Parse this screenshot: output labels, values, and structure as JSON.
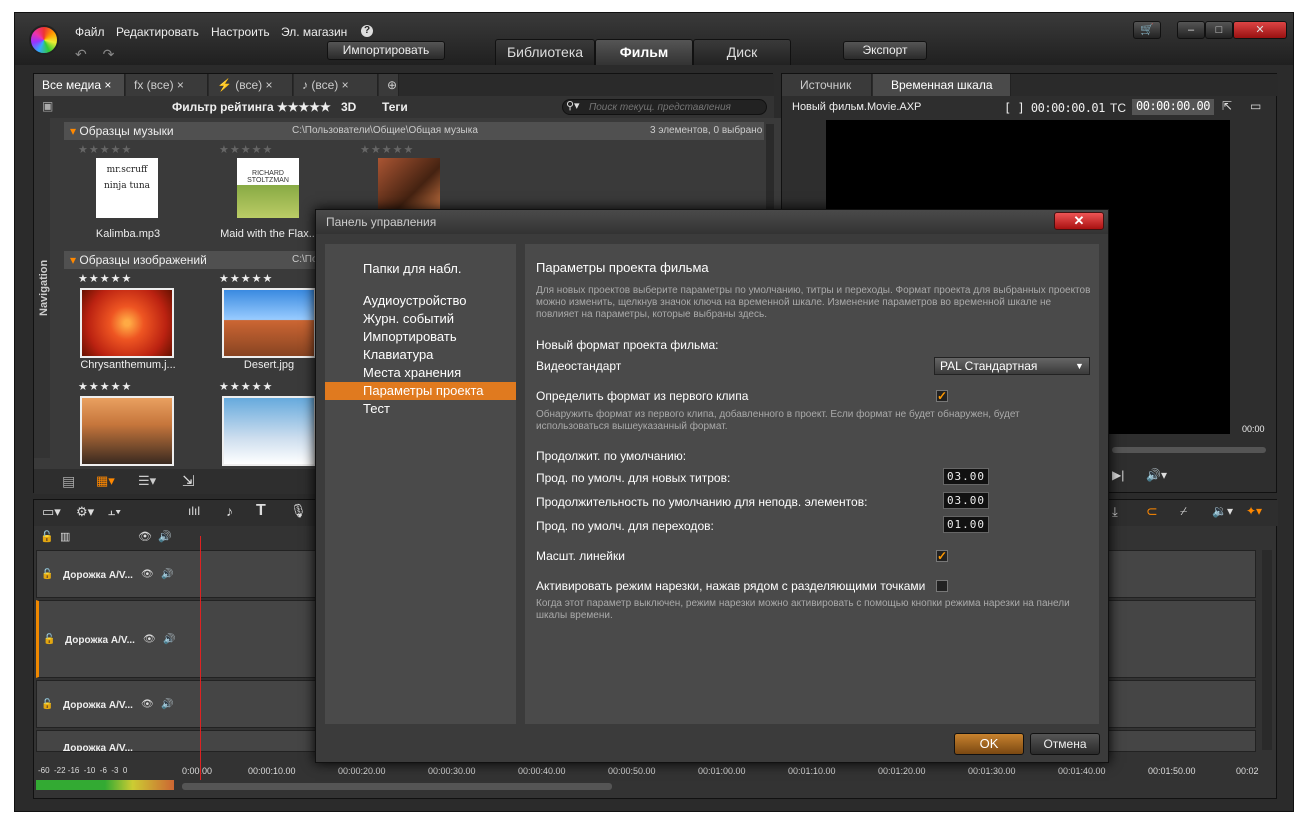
{
  "menu": {
    "file": "Файл",
    "edit": "Редактировать",
    "settings": "Настроить",
    "store": "Эл. магазин",
    "help": "?"
  },
  "toolbar": {
    "import": "Импортировать",
    "export": "Экспорт",
    "undo": "↶ ↷"
  },
  "main_tabs": [
    {
      "label": "Библиотека"
    },
    {
      "label": "Фильм"
    },
    {
      "label": "Диск"
    }
  ],
  "window_controls": {
    "cart": "🛒",
    "min": "–",
    "max": "□",
    "close": "✕"
  },
  "library": {
    "tabs": [
      {
        "label": "Все медиа ×"
      },
      {
        "label": "fx (все) ×"
      },
      {
        "label": "⚡ (все) ×"
      },
      {
        "label": "♪ (все) ×"
      }
    ],
    "rating_filter": "Фильтр рейтинга ★★★★★",
    "threed": "3D",
    "tags": "Теги",
    "search_placeholder": "Поиск текущ. представления",
    "navigation": "Navigation",
    "music_section": {
      "title": "Образцы музыки",
      "path": "C:\\Пользователи\\Общие\\Общая музыка",
      "count": "3 элементов, 0 выбрано"
    },
    "image_section": {
      "title": "Образцы изображений",
      "path": "C:\\Польз"
    },
    "music_items": [
      {
        "name": "Kalimba.mp3",
        "stars": "★★★★★",
        "cover": "mr.scruff ninja tuna"
      },
      {
        "name": "Maid with the Flax...",
        "stars": "★★★★★",
        "cover": "RICHARD STOLTZMAN"
      },
      {
        "name": "",
        "stars": "★★★★★"
      }
    ],
    "image_items": [
      {
        "name": "Chrysanthemum.j...",
        "stars": "★★★★★"
      },
      {
        "name": "Desert.jpg",
        "stars": "★★★★★"
      },
      {
        "name": "",
        "stars": "★★★★★"
      },
      {
        "name": "",
        "stars": "★★★★★"
      }
    ]
  },
  "preview": {
    "tabs": [
      {
        "label": "Источник"
      },
      {
        "label": "Временная шкала"
      }
    ],
    "file": "Новый фильм.Movie.AXP",
    "duration": "[ ] 00:00:00.01",
    "tc_label": "TC",
    "tc": "00:00:00.00",
    "time_end": "00:00"
  },
  "timeline": {
    "tracks": [
      {
        "label": "Дорожка A/V..."
      },
      {
        "label": "Дорожка A/V..."
      },
      {
        "label": "Дорожка A/V..."
      },
      {
        "label": "Дорожка A/V..."
      }
    ],
    "ruler": [
      "0:00.00",
      "00:00:10.00",
      "00:00:20.00",
      "00:00:30.00",
      "00:00:40.00",
      "00:00:50.00",
      "00:01:00.00",
      "00:01:10.00",
      "00:01:20.00",
      "00:01:30.00",
      "00:01:40.00",
      "00:01:50.00",
      "00:02"
    ],
    "meter": "-60  -22 -16  -10  -6  -3  0"
  },
  "dialog": {
    "title": "Панель управления",
    "close": "✕",
    "nav": [
      {
        "label": "Папки для набл."
      },
      {
        "label": "Аудиоустройство"
      },
      {
        "label": "Журн. событий"
      },
      {
        "label": "Импортировать"
      },
      {
        "label": "Клавиатура"
      },
      {
        "label": "Места хранения"
      },
      {
        "label": "Параметры проекта"
      },
      {
        "label": "Тест"
      }
    ],
    "heading": "Параметры проекта фильма",
    "intro": "Для новых проектов выберите параметры по умолчанию, титры и переходы. Формат проекта для выбранных проектов можно изменить, щелкнув значок ключа на временной шкале. Изменение параметров во временной шкале не повлияет на параметры, которые выбраны здесь.",
    "new_format_label": "Новый формат проекта фильма:",
    "video_standard_label": "Видеостандарт",
    "video_standard_value": "PAL Стандартная",
    "detect_label": "Определить формат из первого клипа",
    "detect_desc": "Обнаружить формат из первого клипа, добавленного в проект. Если формат не будет обнаружен, будет использоваться вышеуказанный формат.",
    "duration_heading": "Продолжит. по умолчанию:",
    "title_dur_label": "Прод. по умолч. для новых титров:",
    "title_dur": "03.00",
    "still_dur_label": "Продолжительность по умолчанию для неподв. элементов:",
    "still_dur": "03.00",
    "trans_dur_label": "Прод. по умолч. для переходов:",
    "trans_dur": "01.00",
    "scale_label": "Масшт. линейки",
    "trim_label": "Активировать режим нарезки, нажав рядом с разделяющими точками",
    "trim_desc": "Когда этот параметр выключен, режим нарезки можно активировать с помощью кнопки режима нарезки на панели шкалы времени.",
    "ok": "OK",
    "cancel": "Отмена",
    "check": "✓"
  }
}
